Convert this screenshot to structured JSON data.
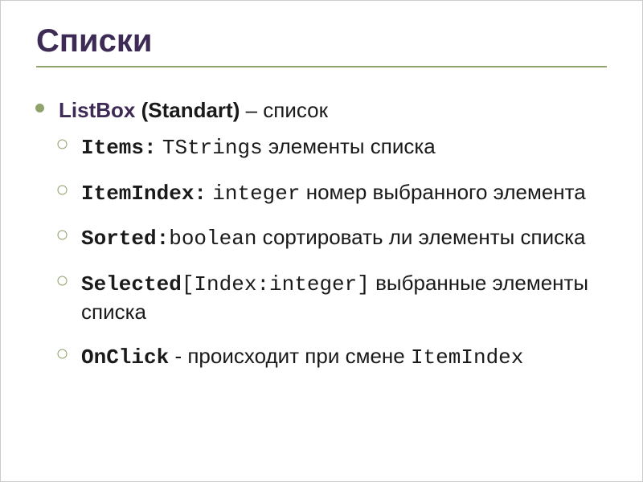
{
  "title": "Списки",
  "main": {
    "name": "ListBox",
    "palette": " (Standart)",
    "desc": " – список"
  },
  "props": [
    {
      "name": "Items:",
      "type": " TStrings",
      "desc": " элементы списка"
    },
    {
      "name": "ItemIndex:",
      "type": " integer",
      "desc": " номер выбранного элемента"
    },
    {
      "name": "Sorted:",
      "type": "boolean",
      "desc": " сортировать ли элементы списка"
    },
    {
      "name": "Selected",
      "type": "[Index:integer]",
      "desc": " выбранные элементы списка"
    },
    {
      "name": "OnClick",
      "desc_before": " - происходит при смене ",
      "ref": "ItemIndex"
    }
  ]
}
